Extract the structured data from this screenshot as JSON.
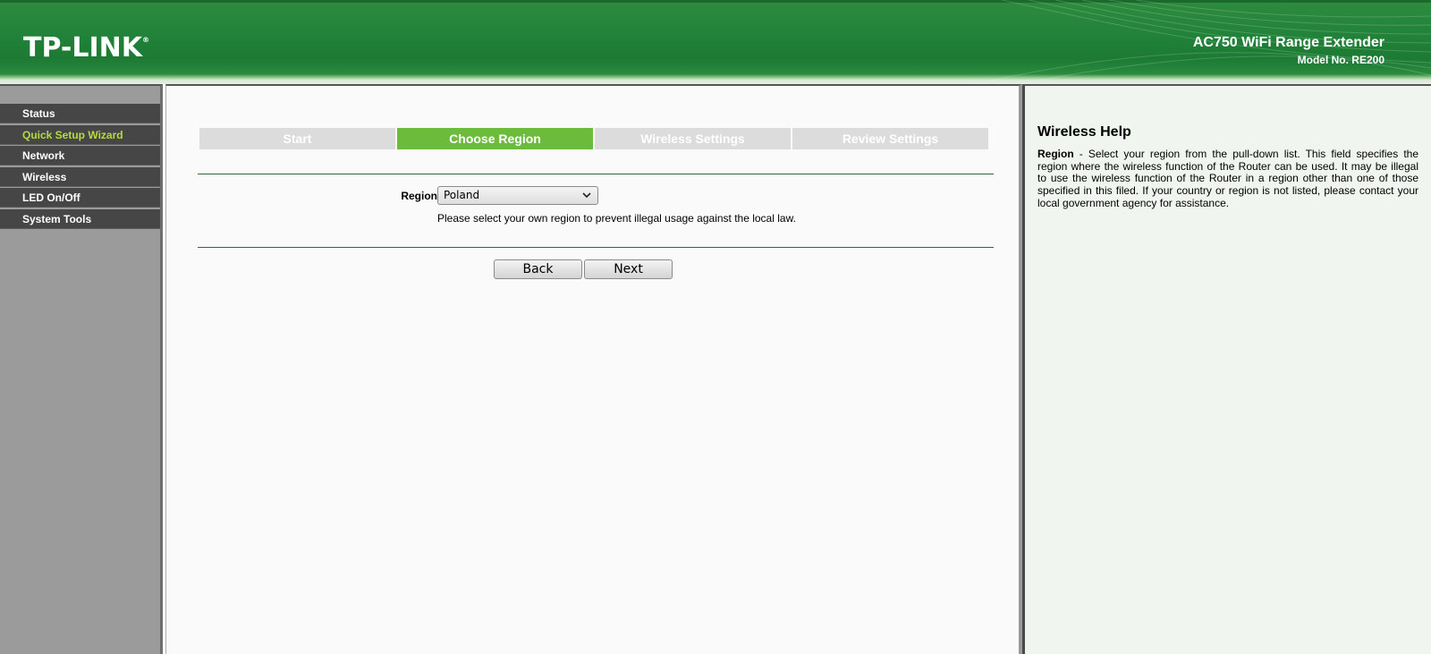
{
  "header": {
    "logo": "TP-LINK",
    "logo_mark": "®",
    "product_title": "AC750 WiFi Range Extender",
    "model_no": "Model No. RE200"
  },
  "sidebar": {
    "items": [
      {
        "label": "Status"
      },
      {
        "label": "Quick Setup Wizard",
        "active": true
      },
      {
        "label": "Network"
      },
      {
        "label": "Wireless"
      },
      {
        "label": "LED On/Off"
      },
      {
        "label": "System Tools"
      }
    ]
  },
  "wizard": {
    "steps": [
      {
        "label": "Start"
      },
      {
        "label": "Choose Region",
        "active": true
      },
      {
        "label": "Wireless Settings"
      },
      {
        "label": "Review Settings"
      }
    ],
    "region_label": "Region:",
    "region_value": "Poland",
    "region_note": "Please select your own region to prevent illegal usage against the local law.",
    "back_label": "Back",
    "next_label": "Next"
  },
  "help": {
    "title": "Wireless Help",
    "term": "Region",
    "text": " - Select your region from the pull-down list. This field specifies the region where the wireless function of the Router can be used. It may be illegal to use the wireless function of the Router in a region other than one of those specified in this filed. If your country or region is not listed, please contact your local government agency for assistance."
  },
  "colors": {
    "brand_green": "#1c7a33",
    "active_step": "#6cbb3c",
    "active_menu_text": "#b5dc3d",
    "menu_bg": "#464646"
  }
}
